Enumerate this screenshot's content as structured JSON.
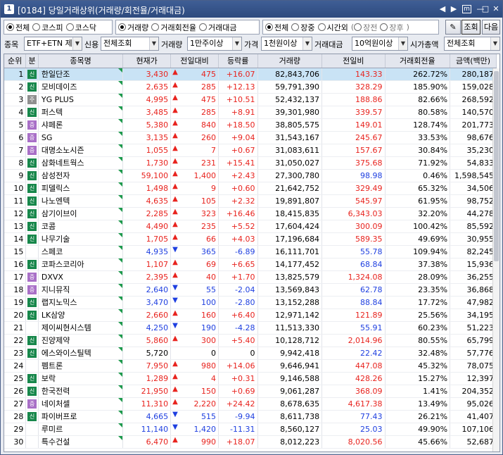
{
  "window": {
    "number": "1",
    "title": "[0184] 당일거래상위(거래량/회전율/거래대금)",
    "controls": [
      "◀",
      "▶",
      "m",
      "—",
      "□",
      "✕"
    ]
  },
  "filters": {
    "market": {
      "options": [
        "전체",
        "코스피",
        "코스닥"
      ],
      "selected": 0
    },
    "sort": {
      "options": [
        "거래량",
        "거래회전율",
        "거래대금"
      ],
      "selected": 0
    },
    "session": {
      "options": [
        "전체",
        "장중",
        "시간외"
      ],
      "selected": 0,
      "sub_options": [
        "장전",
        "장후"
      ]
    },
    "refresh_label": "조회",
    "next_label": "다음",
    "item_label": "종목",
    "item_value": "ETF+ETN 제",
    "credit_label": "신용",
    "credit_value": "전체조회",
    "volume_label": "거래량",
    "volume_value": "1만주이상",
    "price_label": "가격",
    "price_value": "1천원이상",
    "amount_label": "거래대금",
    "amount_value": "10억원이상",
    "mcap_label": "시가총액",
    "mcap_value": "전체조회"
  },
  "table": {
    "columns": [
      "순위",
      "분",
      "종목명",
      "현재가",
      "전일대비",
      "등락률",
      "거래량",
      "전일비",
      "거래회전율",
      "금액(백만)"
    ],
    "rows": [
      {
        "rank": "1",
        "badge": "신",
        "name": "한일단조",
        "price": "3,430",
        "dir": "up",
        "change": "475",
        "rate": "+16.07",
        "volume": "82,843,706",
        "prev_ratio": "143.33",
        "turnover": "262.72%",
        "amount": "280,187"
      },
      {
        "rank": "2",
        "badge": "신",
        "name": "모비데이즈",
        "price": "2,635",
        "dir": "up",
        "change": "285",
        "rate": "+12.13",
        "volume": "59,791,390",
        "prev_ratio": "328.29",
        "turnover": "185.90%",
        "amount": "159,028"
      },
      {
        "rank": "3",
        "badge": "주",
        "name": "YG PLUS",
        "price": "4,995",
        "dir": "up",
        "change": "475",
        "rate": "+10.51",
        "volume": "52,432,137",
        "prev_ratio": "188.86",
        "turnover": "82.66%",
        "amount": "268,592"
      },
      {
        "rank": "4",
        "badge": "신",
        "name": "퍼스텍",
        "price": "3,485",
        "dir": "up",
        "change": "285",
        "rate": "+8.91",
        "volume": "39,301,980",
        "prev_ratio": "339.57",
        "turnover": "80.58%",
        "amount": "140,570"
      },
      {
        "rank": "5",
        "badge": "증",
        "name": "샤페론",
        "price": "5,380",
        "dir": "up",
        "change": "840",
        "rate": "+18.50",
        "volume": "38,805,575",
        "prev_ratio": "149.01",
        "turnover": "128.74%",
        "amount": "201,773"
      },
      {
        "rank": "6",
        "badge": "증",
        "name": "SG",
        "price": "3,135",
        "dir": "up",
        "change": "260",
        "rate": "+9.04",
        "volume": "31,543,167",
        "prev_ratio": "245.67",
        "turnover": "33.53%",
        "amount": "98,676"
      },
      {
        "rank": "7",
        "badge": "증",
        "name": "대명소노시즌",
        "price": "1,055",
        "dir": "up",
        "change": "7",
        "rate": "+0.67",
        "volume": "31,083,611",
        "prev_ratio": "157.67",
        "turnover": "30.84%",
        "amount": "35,230"
      },
      {
        "rank": "8",
        "badge": "신",
        "name": "삼화네트웍스",
        "price": "1,730",
        "dir": "up",
        "change": "231",
        "rate": "+15.41",
        "volume": "31,050,027",
        "prev_ratio": "375.68",
        "turnover": "71.92%",
        "amount": "54,833"
      },
      {
        "rank": "9",
        "badge": "신",
        "name": "삼성전자",
        "price": "59,100",
        "dir": "up",
        "change": "1,400",
        "rate": "+2.43",
        "volume": "27,300,780",
        "prev_ratio": "98.98",
        "turnover": "0.46%",
        "amount": "1,598,545"
      },
      {
        "rank": "10",
        "badge": "신",
        "name": "피델릭스",
        "price": "1,498",
        "dir": "up",
        "change": "9",
        "rate": "+0.60",
        "volume": "21,642,752",
        "prev_ratio": "329.49",
        "turnover": "65.32%",
        "amount": "34,506"
      },
      {
        "rank": "11",
        "badge": "신",
        "name": "나노엔텍",
        "price": "4,635",
        "dir": "up",
        "change": "105",
        "rate": "+2.32",
        "volume": "19,891,807",
        "prev_ratio": "545.97",
        "turnover": "61.95%",
        "amount": "98,752"
      },
      {
        "rank": "12",
        "badge": "신",
        "name": "삼기이브이",
        "price": "2,285",
        "dir": "up",
        "change": "323",
        "rate": "+16.46",
        "volume": "18,415,835",
        "prev_ratio": "6,343.03",
        "turnover": "32.20%",
        "amount": "44,278"
      },
      {
        "rank": "13",
        "badge": "신",
        "name": "코콤",
        "price": "4,490",
        "dir": "up",
        "change": "235",
        "rate": "+5.52",
        "volume": "17,604,424",
        "prev_ratio": "300.09",
        "turnover": "100.42%",
        "amount": "85,592"
      },
      {
        "rank": "14",
        "badge": "신",
        "name": "나무기술",
        "price": "1,705",
        "dir": "up",
        "change": "66",
        "rate": "+4.03",
        "volume": "17,196,684",
        "prev_ratio": "589.35",
        "turnover": "49.69%",
        "amount": "30,955"
      },
      {
        "rank": "15",
        "badge": "",
        "name": "스페코",
        "price": "4,935",
        "dir": "dn",
        "change": "365",
        "rate": "-6.89",
        "volume": "16,111,701",
        "prev_ratio": "55.78",
        "turnover": "109.94%",
        "amount": "82,245"
      },
      {
        "rank": "16",
        "badge": "신",
        "name": "코파스코리아",
        "price": "1,107",
        "dir": "up",
        "change": "69",
        "rate": "+6.65",
        "volume": "14,177,452",
        "prev_ratio": "68.84",
        "turnover": "37.38%",
        "amount": "15,936"
      },
      {
        "rank": "17",
        "badge": "증",
        "name": "DXVX",
        "price": "2,395",
        "dir": "up",
        "change": "40",
        "rate": "+1.70",
        "volume": "13,825,579",
        "prev_ratio": "1,324.08",
        "turnover": "28.09%",
        "amount": "36,255"
      },
      {
        "rank": "18",
        "badge": "증",
        "name": "지니뮤직",
        "price": "2,640",
        "dir": "dn",
        "change": "55",
        "rate": "-2.04",
        "volume": "13,569,843",
        "prev_ratio": "62.78",
        "turnover": "23.35%",
        "amount": "36,868"
      },
      {
        "rank": "19",
        "badge": "신",
        "name": "랩지노믹스",
        "price": "3,470",
        "dir": "dn",
        "change": "100",
        "rate": "-2.80",
        "volume": "13,152,288",
        "prev_ratio": "88.84",
        "turnover": "17.72%",
        "amount": "47,982"
      },
      {
        "rank": "20",
        "badge": "신",
        "name": "LK삼양",
        "price": "2,660",
        "dir": "up",
        "change": "160",
        "rate": "+6.40",
        "volume": "12,971,142",
        "prev_ratio": "121.89",
        "turnover": "25.56%",
        "amount": "34,195"
      },
      {
        "rank": "21",
        "badge": "",
        "name": "제이씨현시스템",
        "price": "4,250",
        "dir": "dn",
        "change": "190",
        "rate": "-4.28",
        "volume": "11,513,330",
        "prev_ratio": "55.91",
        "turnover": "60.23%",
        "amount": "51,223"
      },
      {
        "rank": "22",
        "badge": "신",
        "name": "진양제약",
        "price": "5,860",
        "dir": "up",
        "change": "300",
        "rate": "+5.40",
        "volume": "10,128,712",
        "prev_ratio": "2,014.96",
        "turnover": "80.55%",
        "amount": "65,799"
      },
      {
        "rank": "23",
        "badge": "신",
        "name": "에스와이스틸텍",
        "price": "5,720",
        "dir": "nt",
        "change": "0",
        "rate": "0",
        "volume": "9,942,418",
        "prev_ratio": "22.42",
        "turnover": "32.48%",
        "amount": "57,776"
      },
      {
        "rank": "24",
        "badge": "",
        "name": "펨트론",
        "price": "7,950",
        "dir": "up",
        "change": "980",
        "rate": "+14.06",
        "volume": "9,646,941",
        "prev_ratio": "447.08",
        "turnover": "45.32%",
        "amount": "78,075"
      },
      {
        "rank": "25",
        "badge": "신",
        "name": "보락",
        "price": "1,289",
        "dir": "up",
        "change": "4",
        "rate": "+0.31",
        "volume": "9,146,588",
        "prev_ratio": "428.26",
        "turnover": "15.27%",
        "amount": "12,397"
      },
      {
        "rank": "26",
        "badge": "신",
        "name": "한국전력",
        "price": "21,950",
        "dir": "up",
        "change": "150",
        "rate": "+0.69",
        "volume": "9,061,287",
        "prev_ratio": "368.09",
        "turnover": "1.41%",
        "amount": "204,352"
      },
      {
        "rank": "27",
        "badge": "증",
        "name": "네이처셀",
        "price": "11,310",
        "dir": "up",
        "change": "2,220",
        "rate": "+24.42",
        "volume": "8,678,635",
        "prev_ratio": "4,617.38",
        "turnover": "13.49%",
        "amount": "95,026"
      },
      {
        "rank": "28",
        "badge": "신",
        "name": "파이버프로",
        "price": "4,665",
        "dir": "dn",
        "change": "515",
        "rate": "-9.94",
        "volume": "8,611,738",
        "prev_ratio": "77.43",
        "turnover": "26.21%",
        "amount": "41,407"
      },
      {
        "rank": "29",
        "badge": "",
        "name": "루미르",
        "price": "11,140",
        "dir": "dn",
        "change": "1,420",
        "rate": "-11.31",
        "volume": "8,560,127",
        "prev_ratio": "25.03",
        "turnover": "49.90%",
        "amount": "107,106"
      },
      {
        "rank": "30",
        "badge": "",
        "name": "특수건설",
        "price": "6,470",
        "dir": "up",
        "change": "990",
        "rate": "+18.07",
        "volume": "8,012,223",
        "prev_ratio": "8,020.56",
        "turnover": "45.66%",
        "amount": "52,687"
      }
    ]
  },
  "colors": {
    "up": "#e8231e",
    "down": "#1e3fe0",
    "title_bg": "#2d4a7e",
    "selected_row": "#c9e3f5"
  },
  "icons": {
    "settings": "pin-icon",
    "up_arrow": "▲",
    "down_arrow": "▼"
  }
}
